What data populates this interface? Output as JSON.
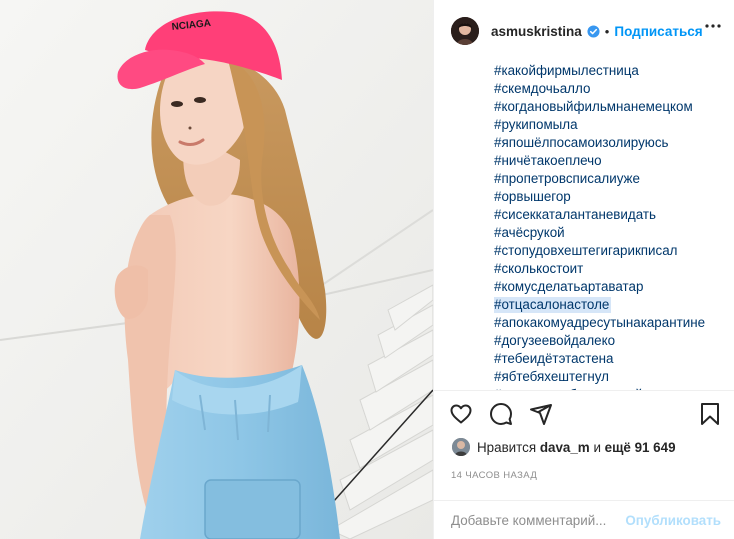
{
  "photo": {
    "alt_icon": "post-photo",
    "cap_text": "NCIAGA"
  },
  "header": {
    "username": "asmuskristina",
    "separator": "•",
    "follow_label": "Подписаться",
    "more_icon": "more-horizontal-icon",
    "verified_icon": "verified-badge-icon"
  },
  "caption": {
    "hashtags": [
      "#какойфирмылестница",
      "#скемдочьалло",
      "#когдановыйфильмнанемецком",
      "#рукипомыла",
      "#япошёлпосамоизолируюсь",
      "#ничётакоеплечо",
      "#пропетровсписалиуже",
      "#орвышегор",
      "#сисеккаталантаневидать",
      "#ачёсрукой",
      "#стопудовхештегигарикписал",
      "#сколькостоит",
      "#комусделатьартаватар",
      "#отцасалонастоле",
      "#апокакомуадресутынакарантине",
      "#догузеевойдалеко",
      "#тебеидётэтастена",
      "#ябтебяхештегнул",
      "#текстспасибочтоживой"
    ],
    "highlighted_index": 13
  },
  "actions": {
    "like_icon": "heart-icon",
    "comment_icon": "comment-icon",
    "share_icon": "share-icon",
    "save_icon": "bookmark-icon"
  },
  "likes": {
    "prefix": "Нравится",
    "user": "dava_m",
    "conj": "и",
    "others": "ещё 91 649"
  },
  "time": "14 ЧАСОВ НАЗАД",
  "comment": {
    "placeholder": "Добавьте комментарий...",
    "publish_label": "Опубликовать"
  },
  "colors": {
    "accent": "#0095f6",
    "link": "#00376b",
    "muted": "#8e8e8e",
    "cap": "#ff3f78",
    "jeans": "#8ec6e6"
  }
}
